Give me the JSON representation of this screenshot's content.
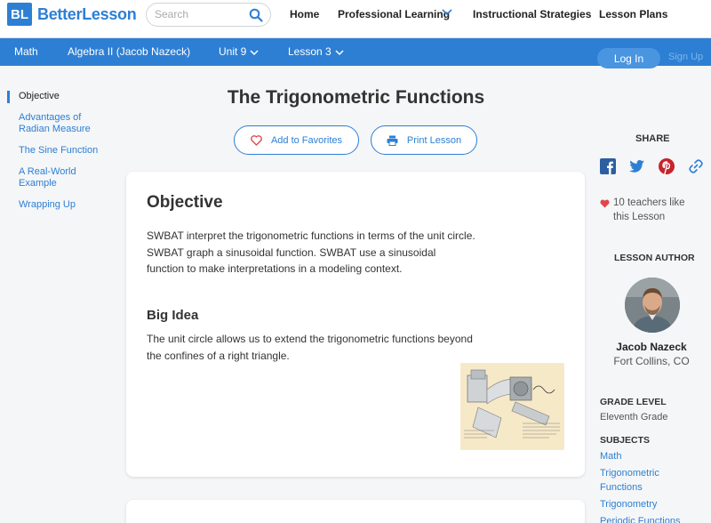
{
  "brand": {
    "logo_mark": "BL",
    "logo_text": "BetterLesson",
    "color": "#2d7fd4"
  },
  "search": {
    "placeholder": "Search",
    "icon": "search-icon"
  },
  "topnav": {
    "home": "Home",
    "professional_learning": "Professional Learning",
    "instructional_strategies": "Instructional Strategies",
    "lesson_plans": "Lesson Plans"
  },
  "breadcrumb": {
    "subject": "Math",
    "course": "Algebra II (Jacob Nazeck)",
    "unit": "Unit 9",
    "lesson": "Lesson 3"
  },
  "auth": {
    "login": "Log In",
    "signup": "Sign Up"
  },
  "sidenav": [
    {
      "label": "Objective",
      "active": true
    },
    {
      "label": "Advantages of Radian Measure",
      "active": false
    },
    {
      "label": "The Sine Function",
      "active": false
    },
    {
      "label": "A Real-World Example",
      "active": false
    },
    {
      "label": "Wrapping Up",
      "active": false
    }
  ],
  "lesson": {
    "title": "The Trigonometric Functions",
    "add_favorites": "Add to Favorites",
    "print": "Print Lesson",
    "objective_heading": "Objective",
    "objective_text": "SWBAT interpret the trigonometric functions in terms of the unit circle.  SWBAT graph a sinusoidal function.  SWBAT use a sinusoidal function to make interpretations in a modeling context.",
    "big_idea_heading": "Big Idea",
    "big_idea_text": "The unit circle allows us to extend the trigonometric functions beyond the confines of a right triangle."
  },
  "sidebar": {
    "share_title": "SHARE",
    "share_icons": [
      "facebook-icon",
      "twitter-icon",
      "pinterest-icon",
      "link-icon"
    ],
    "likes": "10 teachers like this Lesson",
    "author_title": "LESSON AUTHOR",
    "author_name": "Jacob Nazeck",
    "author_location": "Fort Collins, CO",
    "grade_title": "GRADE LEVEL",
    "grade_value": "Eleventh Grade",
    "subjects_title": "SUBJECTS",
    "subjects": [
      "Math",
      "Trigonometric Functions",
      "Trigonometry",
      "Periodic Functions"
    ]
  }
}
